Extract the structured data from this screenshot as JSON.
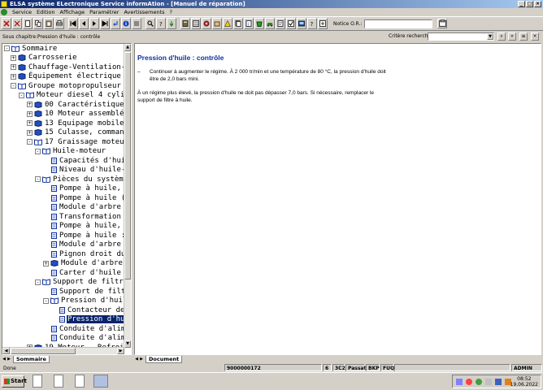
{
  "window": {
    "title": "ELSA système ELectronique Service informAtion - [Manuel de réparation]",
    "controls": [
      "_",
      "□",
      "×"
    ]
  },
  "menu": {
    "items": [
      "Service",
      "Edition",
      "Affichage",
      "Paramétrer",
      "Avertissements",
      "?"
    ]
  },
  "toolbar": {
    "order_label": "Notice O.R.:",
    "order_value": ""
  },
  "subchapter": {
    "label": "Sous chapitre:Pression d'huile : contrôle",
    "criteria_label": "Critère recherche:",
    "criteria_value": ""
  },
  "tree": {
    "nodes": [
      {
        "label": "Sommaire",
        "type": "book-open",
        "expander": "-"
      },
      {
        "label": "Carrosserie",
        "type": "book",
        "expander": "+"
      },
      {
        "label": "Chauffage-Ventilation-C",
        "type": "book",
        "expander": "+"
      },
      {
        "label": "Équipement électrique",
        "type": "book",
        "expander": "+"
      },
      {
        "label": "Groupe motopropulseur",
        "type": "book-open",
        "expander": "-"
      },
      {
        "label": "Moteur diesel 4 cylin",
        "type": "book-open",
        "expander": "-"
      },
      {
        "label": "00 Caractéristiques",
        "type": "book",
        "expander": "+"
      },
      {
        "label": "10 Moteur assemblé,",
        "type": "book",
        "expander": "+"
      },
      {
        "label": "13 Equipage mobile,",
        "type": "book",
        "expander": "+"
      },
      {
        "label": "15 Culasse, commande",
        "type": "book",
        "expander": "+"
      },
      {
        "label": "17 Graissage moteur",
        "type": "book-open",
        "expander": "-"
      },
      {
        "label": "Huile-moteur",
        "type": "book-open",
        "expander": "-"
      },
      {
        "label": "Capacités d'huil",
        "type": "doc",
        "expander": ""
      },
      {
        "label": "Niveau d'huile-m",
        "type": "doc",
        "expander": ""
      },
      {
        "label": "Pièces du système",
        "type": "book-open",
        "expander": "-"
      },
      {
        "label": "Pompe à huile, c",
        "type": "doc",
        "expander": ""
      },
      {
        "label": "Pompe à huile (s",
        "type": "doc",
        "expander": ""
      },
      {
        "label": "Module d'arbre c",
        "type": "doc",
        "expander": ""
      },
      {
        "label": "Transformation e",
        "type": "doc",
        "expander": ""
      },
      {
        "label": "Pompe à huile, c",
        "type": "doc",
        "expander": ""
      },
      {
        "label": "Pompe à huile :",
        "type": "doc",
        "expander": ""
      },
      {
        "label": "Module d'arbre c",
        "type": "doc",
        "expander": ""
      },
      {
        "label": "Pignon droit du",
        "type": "doc",
        "expander": ""
      },
      {
        "label": "Module d'arbre c",
        "type": "book",
        "expander": "+"
      },
      {
        "label": "Carter d'huile :",
        "type": "doc",
        "expander": ""
      },
      {
        "label": "Support de filtre",
        "type": "book-open",
        "expander": "-"
      },
      {
        "label": "Support de filtr",
        "type": "doc",
        "expander": ""
      },
      {
        "label": "Pression d'huile",
        "type": "book-open",
        "expander": "-"
      },
      {
        "label": "Contacteur de",
        "type": "doc",
        "expander": ""
      },
      {
        "label": "Pression d'hui",
        "type": "doc",
        "expander": "",
        "selected": true
      },
      {
        "label": "Conduite d'alime",
        "type": "doc",
        "expander": ""
      },
      {
        "label": "Conduite d'alime",
        "type": "doc",
        "expander": ""
      },
      {
        "label": "19 Moteur - Refroid",
        "type": "book",
        "expander": "+"
      }
    ],
    "tab_label": "Sommaire"
  },
  "document": {
    "title": "Pression d'huile : contrôle",
    "bullet_marker": "–",
    "bullet": "Continuer à augmenter le régime. À 2 000 tr/min et une température de 80 °C, la pression d'huile doit être de 2,0 bars mini.",
    "paragraph": "À un régime plus élevé, la pression d'huile ne doit pas dépasser 7,0 bars. Si nécessaire, remplacer le support de filtre à huile.",
    "tab_label": "Document"
  },
  "status": {
    "left": "Done",
    "order_number": "9000000172",
    "field_6": "6",
    "field_3c2": "3C2",
    "model": "Passat",
    "engine": "BKP",
    "gearbox": "FUQ",
    "user": "ADMIN"
  },
  "taskbar": {
    "start_label": "Start",
    "time": "08:52",
    "date": "19.06.2022"
  },
  "colors": {
    "title_bar": "#0a246a",
    "doc_title": "#1030a0",
    "selection": "#0a246a",
    "chrome": "#d4d0c8"
  }
}
